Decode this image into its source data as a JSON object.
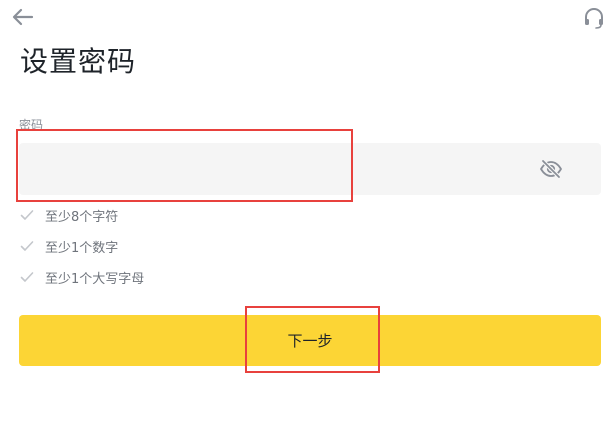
{
  "header": {
    "back_icon": "arrow-left-icon",
    "support_icon": "headset-icon",
    "title": "设置密码"
  },
  "password": {
    "label": "密码",
    "value": "",
    "placeholder": "",
    "visibility_icon": "eye-off-icon"
  },
  "requirements": [
    {
      "text": "至少8个字符",
      "met": false
    },
    {
      "text": "至少1个数字",
      "met": false
    },
    {
      "text": "至少1个大写字母",
      "met": false
    }
  ],
  "actions": {
    "next_label": "下一步"
  },
  "colors": {
    "accent": "#fcd535",
    "highlight": "#e8413d",
    "input_bg": "#f5f5f5",
    "text_primary": "#1e2329",
    "text_secondary": "#8a8f98"
  }
}
